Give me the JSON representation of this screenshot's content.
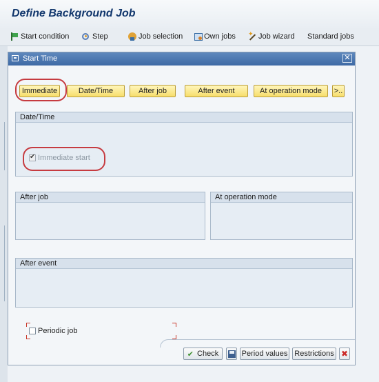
{
  "window": {
    "title": "Define Background Job"
  },
  "toolbar": {
    "items": [
      {
        "label": "Start condition",
        "icon": "flag-icon"
      },
      {
        "label": "Step",
        "icon": "step-icon"
      },
      {
        "label": "Job selection",
        "icon": "job-selection-icon"
      },
      {
        "label": "Own jobs",
        "icon": "own-jobs-icon"
      },
      {
        "label": "Job wizard",
        "icon": "wizard-icon"
      },
      {
        "label": "Standard jobs",
        "icon": ""
      }
    ]
  },
  "dialog": {
    "title": "Start Time",
    "close_label": "✕",
    "buttons": {
      "immediate": "Immediate",
      "datetime": "Date/Time",
      "after_job": "After job",
      "after_event": "After event",
      "at_operation_mode": "At operation mode",
      "more": ">.."
    },
    "groups": {
      "datetime": {
        "title": "Date/Time",
        "immediate_start_label": "Immediate start",
        "immediate_start_checked": true
      },
      "after_job": {
        "title": "After job"
      },
      "at_operation_mode": {
        "title": "At operation mode"
      },
      "after_event": {
        "title": "After event"
      }
    },
    "periodic_job": {
      "label": "Periodic job",
      "checked": false
    },
    "footer": {
      "check": "Check",
      "period_values": "Period values",
      "restrictions": "Restrictions"
    }
  },
  "colors": {
    "title_text": "#12376d",
    "dialog_title_bar": "#4a76b0",
    "yellow_button": "#f7de6b",
    "annotation_red": "#c63b40"
  }
}
